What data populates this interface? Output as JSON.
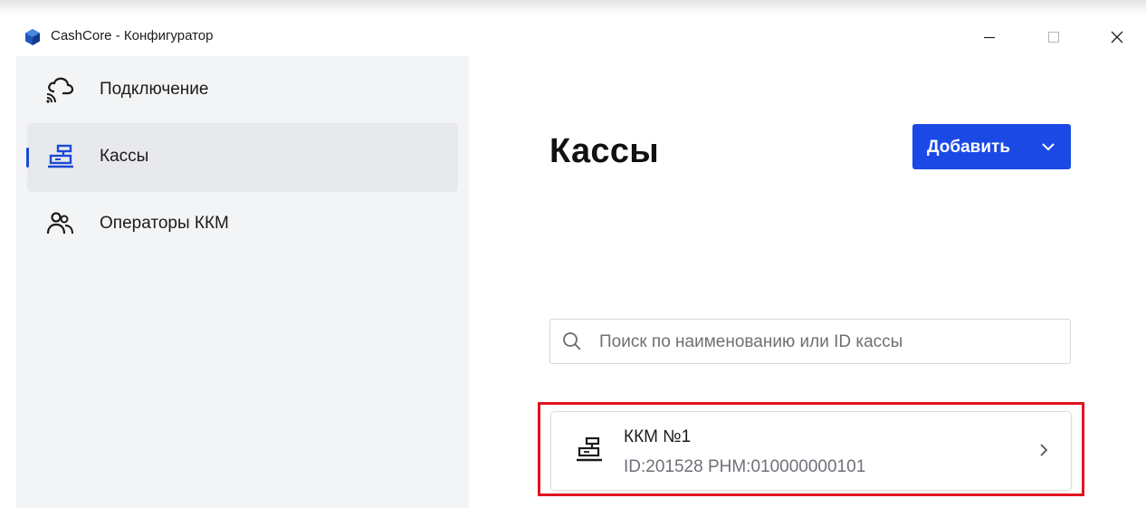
{
  "window": {
    "title": "CashCore - Конфигуратор",
    "controls": {
      "minimize": "—",
      "maximize": "☐",
      "close": "✕"
    }
  },
  "sidebar": {
    "items": [
      {
        "label": "Подключение",
        "icon": "cloud-wifi-icon",
        "active": false
      },
      {
        "label": "Кассы",
        "icon": "cash-register-icon",
        "active": true
      },
      {
        "label": "Операторы ККМ",
        "icon": "users-icon",
        "active": false
      }
    ]
  },
  "main": {
    "title": "Кассы",
    "add_button": {
      "label": "Добавить",
      "icon": "chevron-down-icon"
    },
    "search": {
      "placeholder": "Поиск по наименованию или ID кассы",
      "value": ""
    },
    "registers": [
      {
        "name": "ККМ №1",
        "meta": "ID:201528 РНМ:010000000101",
        "icon": "cash-register-icon"
      }
    ]
  },
  "colors": {
    "accent": "#1a49e6",
    "highlight": "#e0141e",
    "sidebar_bg": "#f3f4f6",
    "active_item_bg": "#e8e9ec"
  }
}
